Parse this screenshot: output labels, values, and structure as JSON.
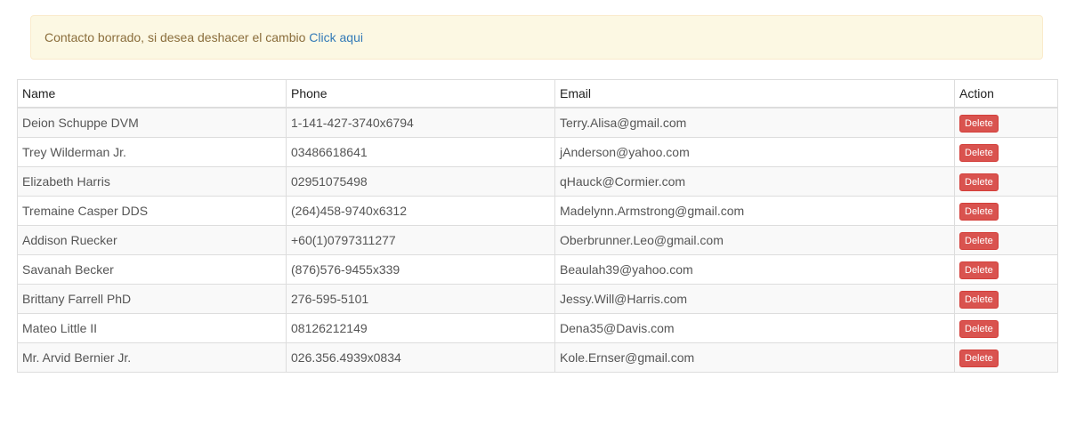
{
  "alert": {
    "message": "Contacto borrado, si desea deshacer el cambio ",
    "link_label": "Click aqui"
  },
  "table": {
    "headers": {
      "name": "Name",
      "phone": "Phone",
      "email": "Email",
      "action": "Action"
    },
    "rows": [
      {
        "name": "Deion Schuppe DVM",
        "phone": "1-141-427-3740x6794",
        "email": "Terry.Alisa@gmail.com",
        "action": "Delete"
      },
      {
        "name": "Trey Wilderman Jr.",
        "phone": "03486618641",
        "email": "jAnderson@yahoo.com",
        "action": "Delete"
      },
      {
        "name": "Elizabeth Harris",
        "phone": "02951075498",
        "email": "qHauck@Cormier.com",
        "action": "Delete"
      },
      {
        "name": "Tremaine Casper DDS",
        "phone": "(264)458-9740x6312",
        "email": "Madelynn.Armstrong@gmail.com",
        "action": "Delete"
      },
      {
        "name": "Addison Ruecker",
        "phone": "+60(1)0797311277",
        "email": "Oberbrunner.Leo@gmail.com",
        "action": "Delete"
      },
      {
        "name": "Savanah Becker",
        "phone": "(876)576-9455x339",
        "email": "Beaulah39@yahoo.com",
        "action": "Delete"
      },
      {
        "name": "Brittany Farrell PhD",
        "phone": "276-595-5101",
        "email": "Jessy.Will@Harris.com",
        "action": "Delete"
      },
      {
        "name": "Mateo Little II",
        "phone": "08126212149",
        "email": "Dena35@Davis.com",
        "action": "Delete"
      },
      {
        "name": "Mr. Arvid Bernier Jr.",
        "phone": "026.356.4939x0834",
        "email": "Kole.Ernser@gmail.com",
        "action": "Delete"
      }
    ]
  },
  "colors": {
    "alert_background": "#fcf8e3",
    "alert_text": "#8a6d3b",
    "link": "#337ab7",
    "danger": "#d9534f"
  }
}
